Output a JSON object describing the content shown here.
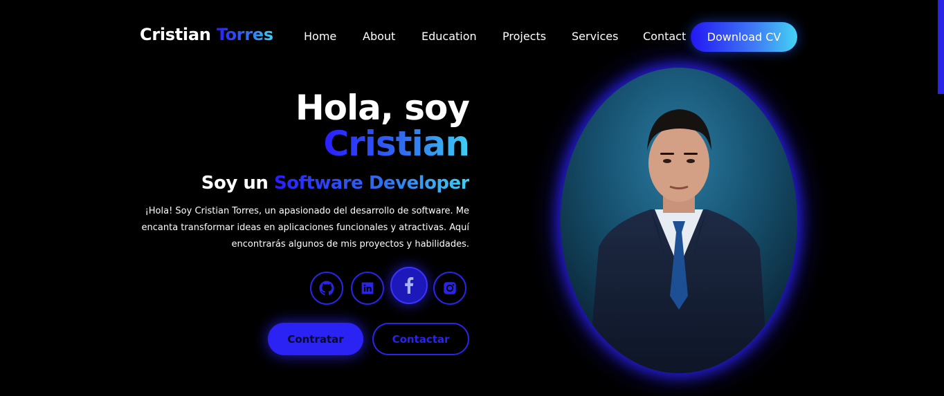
{
  "nav": {
    "logo_first": "Cristian",
    "logo_second": "Torres",
    "links": [
      "Home",
      "About",
      "Education",
      "Projects",
      "Services",
      "Contact"
    ],
    "download_label": "Download CV"
  },
  "hero": {
    "greeting": "Hola, soy",
    "name": "Cristian",
    "role_prefix": "Soy un",
    "role_highlight": "Software Developer",
    "intro": "¡Hola! Soy Cristian Torres, un apasionado del desarrollo de software. Me encanta transformar ideas en aplicaciones funcionales y atractivas. Aquí encontrarás algunos de mis proyectos y habilidades."
  },
  "social": [
    {
      "icon": "github-icon",
      "active": false
    },
    {
      "icon": "linkedin-icon",
      "active": false
    },
    {
      "icon": "facebook-icon",
      "active": true
    },
    {
      "icon": "instagram-icon",
      "active": false
    }
  ],
  "buttons": {
    "hire": "Contratar",
    "contact": "Contactar"
  },
  "colors": {
    "accent_blue": "#2a24e8",
    "gradient_start": "#2418f3",
    "gradient_end": "#44d3f4",
    "background": "#000000"
  }
}
